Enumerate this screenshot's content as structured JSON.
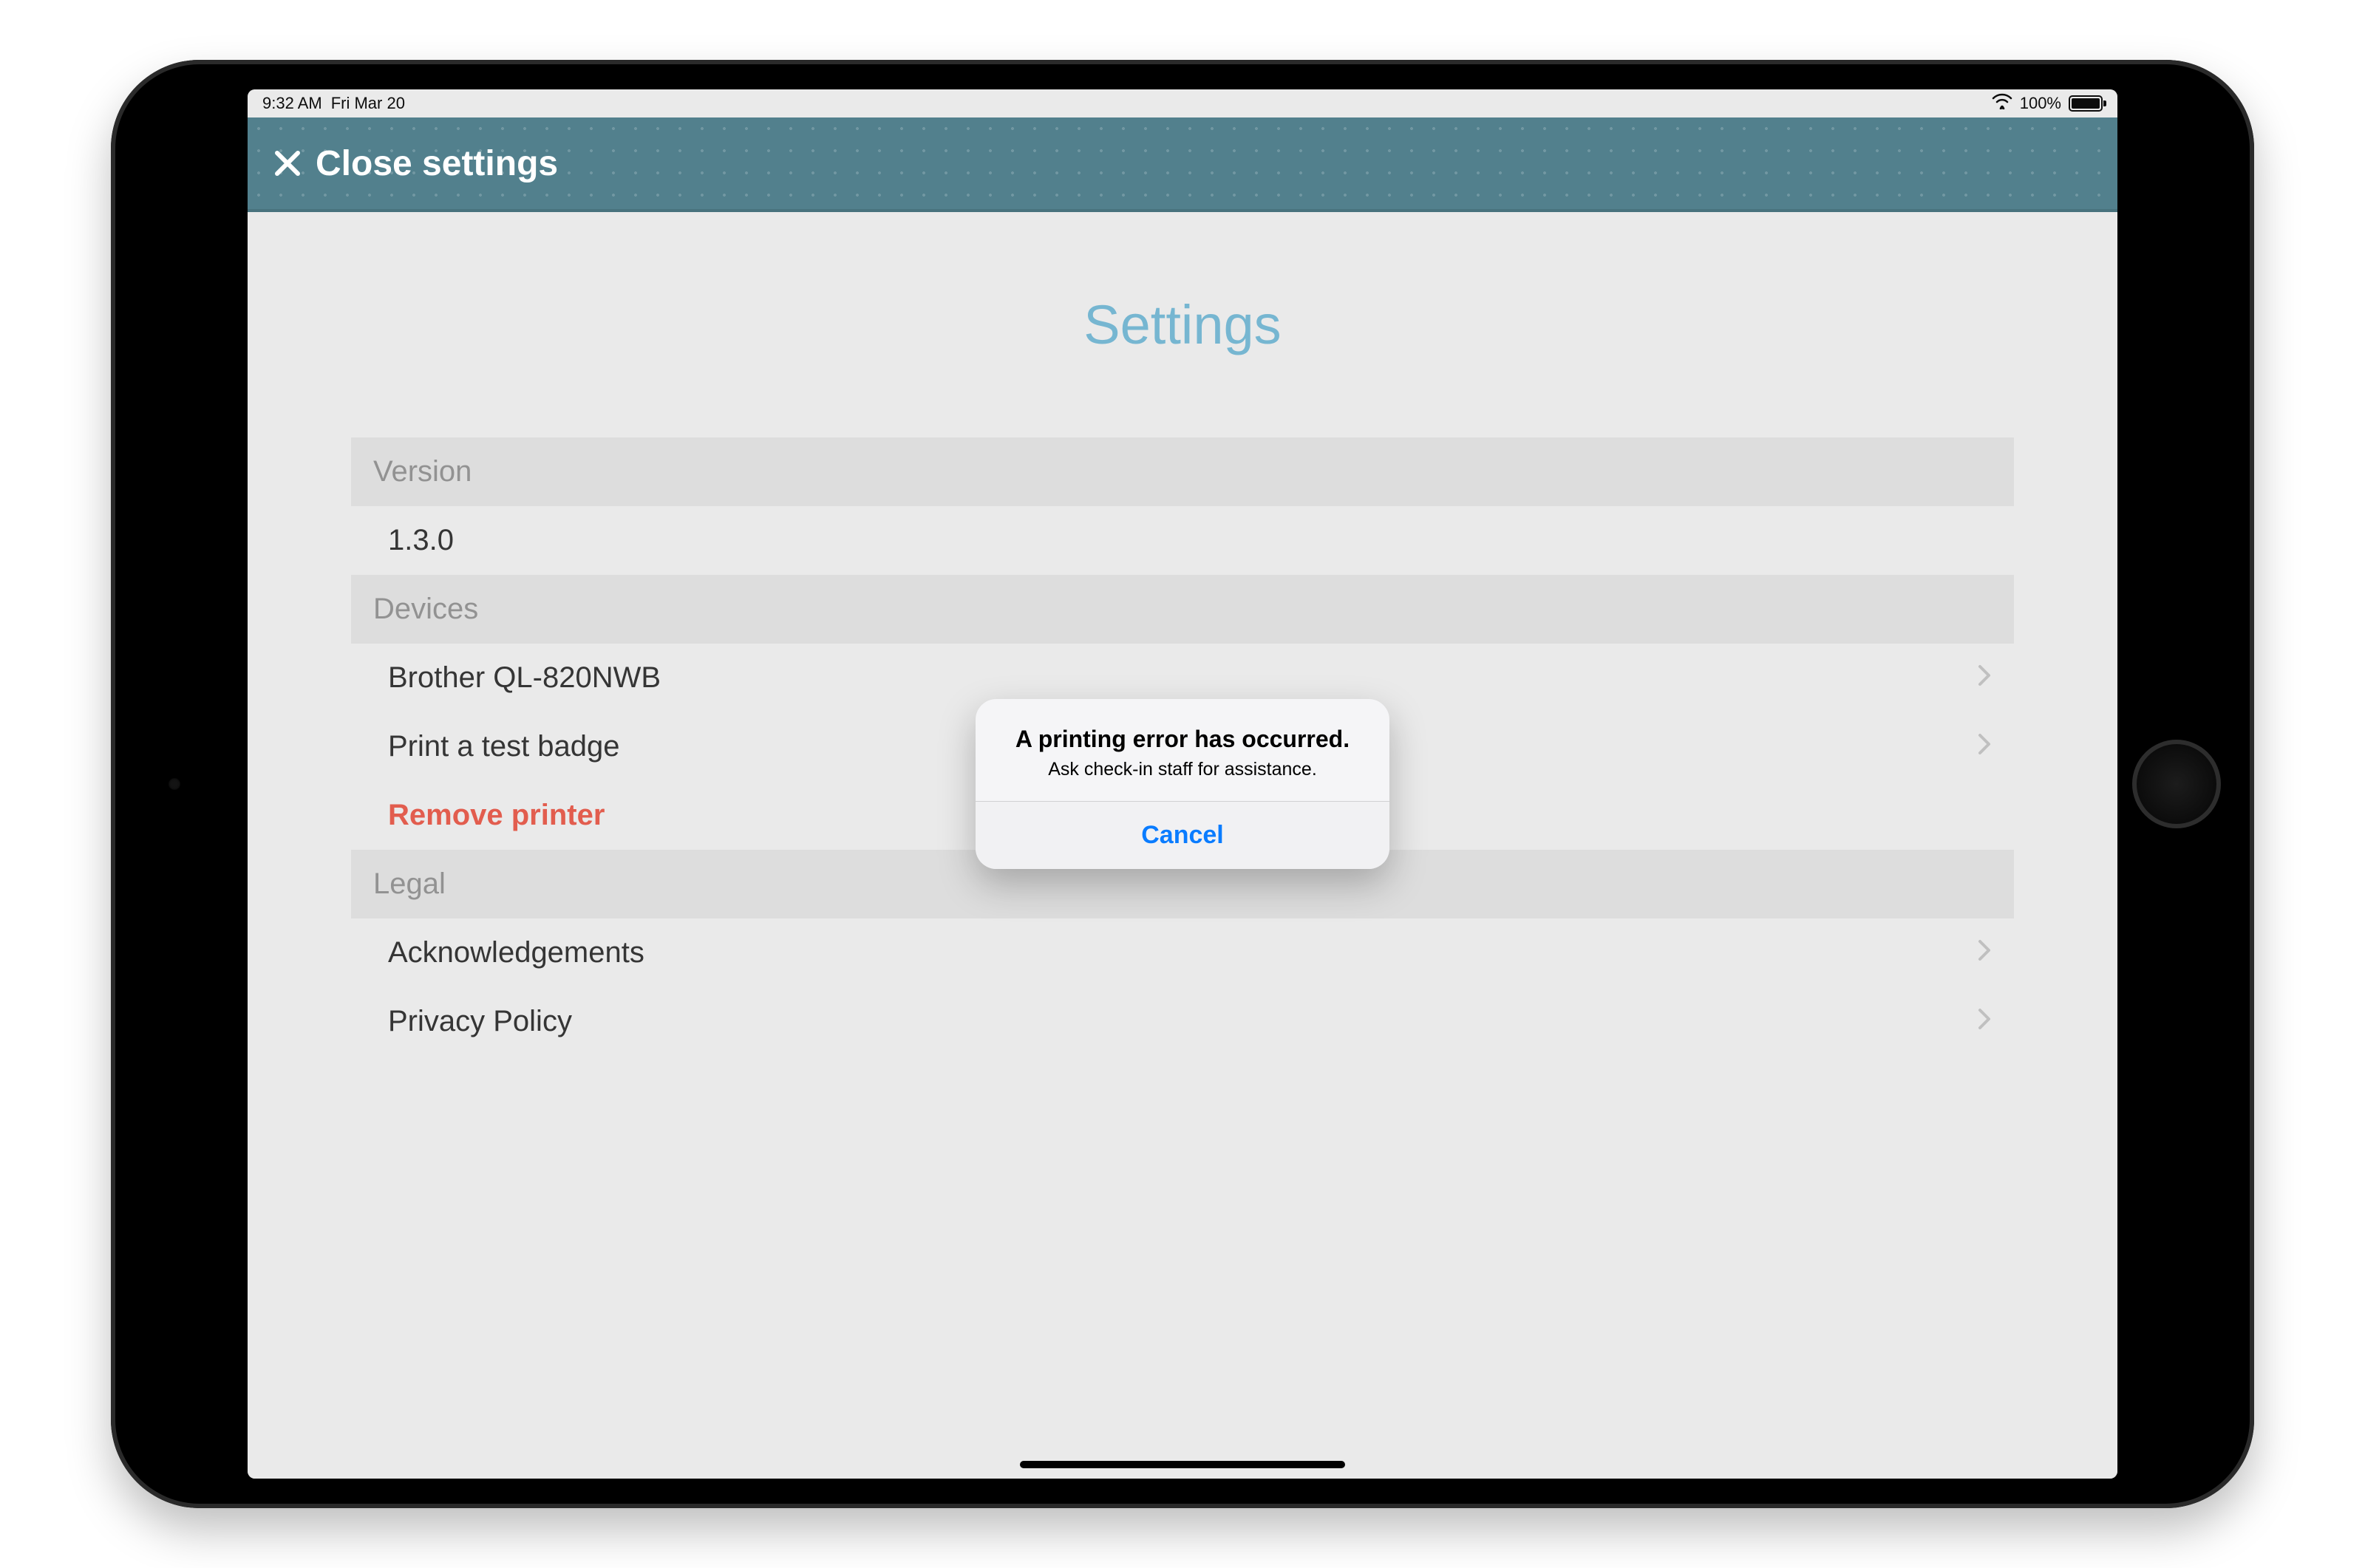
{
  "status_bar": {
    "time": "9:32 AM",
    "date": "Fri Mar 20",
    "battery_percent": "100%"
  },
  "app_bar": {
    "close_label": "Close settings"
  },
  "page": {
    "title": "Settings"
  },
  "sections": {
    "version": {
      "header": "Version",
      "value": "1.3.0"
    },
    "devices": {
      "header": "Devices",
      "printer": "Brother QL-820NWB",
      "test_badge": "Print a test badge",
      "remove_printer": "Remove printer"
    },
    "legal": {
      "header": "Legal",
      "acknowledgements": "Acknowledgements",
      "privacy": "Privacy Policy"
    }
  },
  "alert": {
    "title": "A printing error has occurred.",
    "message": "Ask check-in staff for assistance.",
    "cancel": "Cancel"
  },
  "colors": {
    "accent": "#6fb3cf",
    "app_bar": "#497a87",
    "destructive": "#e15545",
    "ios_blue": "#0a7cff"
  }
}
